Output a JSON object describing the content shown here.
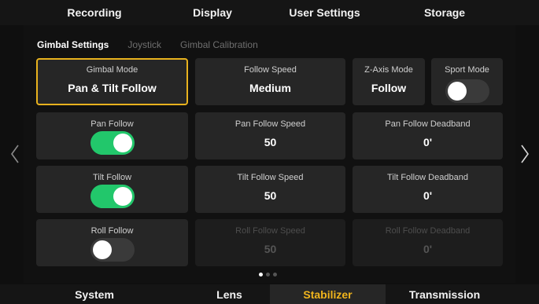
{
  "top_tabs": [
    "Recording",
    "Display",
    "User Settings",
    "Storage"
  ],
  "sub_tabs": [
    "Gimbal Settings",
    "Joystick",
    "Gimbal Calibration"
  ],
  "cards": {
    "gimbal_mode": {
      "label": "Gimbal Mode",
      "value": "Pan & Tilt Follow"
    },
    "follow_speed": {
      "label": "Follow Speed",
      "value": "Medium"
    },
    "z_axis_mode": {
      "label": "Z-Axis Mode",
      "value": "Follow"
    },
    "sport_mode": {
      "label": "Sport Mode",
      "state": "off"
    },
    "pan_follow": {
      "label": "Pan Follow",
      "state": "on"
    },
    "pan_follow_speed": {
      "label": "Pan Follow Speed",
      "value": "50"
    },
    "pan_follow_deadband": {
      "label": "Pan Follow Deadband",
      "value": "0'"
    },
    "tilt_follow": {
      "label": "Tilt Follow",
      "state": "on"
    },
    "tilt_follow_speed": {
      "label": "Tilt Follow Speed",
      "value": "50"
    },
    "tilt_follow_deadband": {
      "label": "Tilt Follow Deadband",
      "value": "0'"
    },
    "roll_follow": {
      "label": "Roll Follow",
      "state": "off"
    },
    "roll_follow_speed": {
      "label": "Roll Follow Speed",
      "value": "50"
    },
    "roll_follow_deadband": {
      "label": "Roll Follow Deadband",
      "value": "0'"
    }
  },
  "pagination": {
    "pages": 3,
    "current": 1
  },
  "bottom_tabs": [
    "System",
    "Lens",
    "Stabilizer",
    "Transmission"
  ],
  "colors": {
    "accent": "#f0b41c",
    "toggle_on": "#22c76b",
    "selected_border": "#e8b21e"
  },
  "icons": {
    "left": "chevron-left-icon",
    "right": "chevron-right-icon"
  }
}
